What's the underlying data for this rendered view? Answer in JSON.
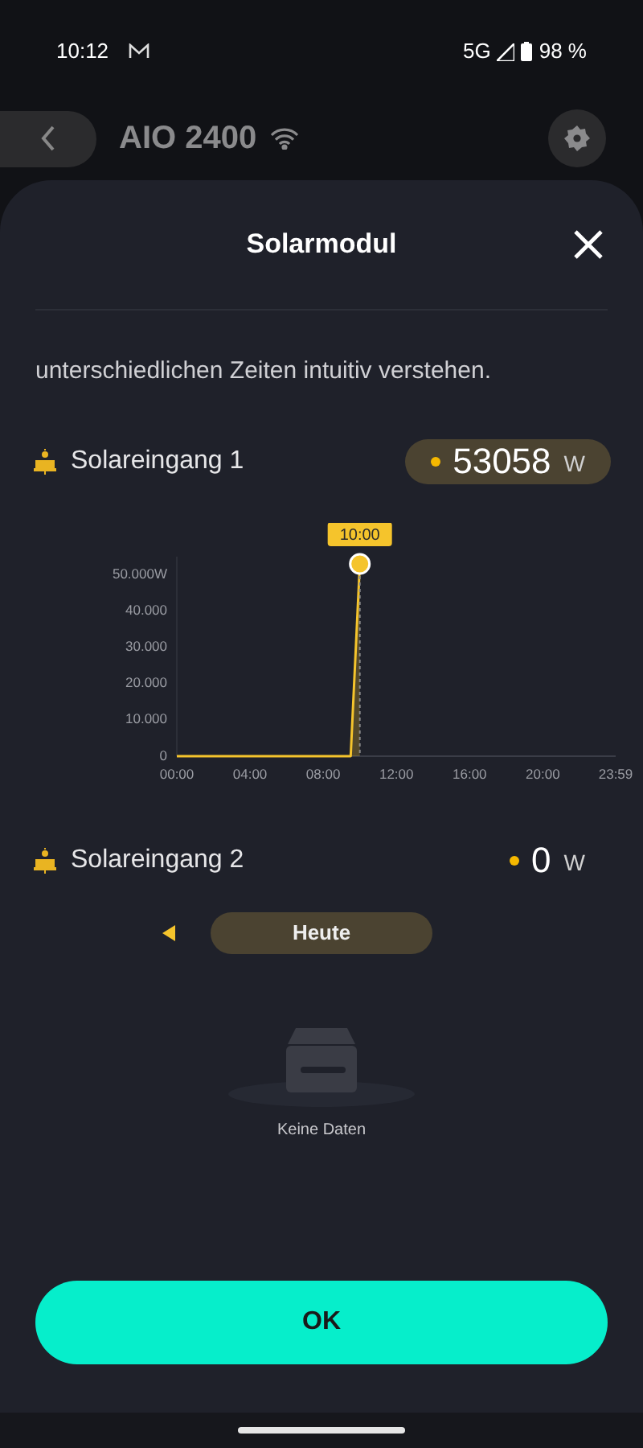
{
  "status_bar": {
    "time": "10:12",
    "network": "5G",
    "battery": "98 %"
  },
  "header": {
    "title": "AIO 2400"
  },
  "sheet": {
    "title": "Solarmodul",
    "intro": "unterschiedlichen Zeiten intuitiv verstehen.",
    "inputs": [
      {
        "label": "Solareingang 1",
        "value": "53058",
        "unit": "W",
        "highlighted": true,
        "chart_data": {
          "type": "line",
          "x": [
            0,
            9.5,
            10
          ],
          "values": [
            0,
            0,
            53000
          ],
          "xlim": [
            0,
            23.98
          ],
          "xticks": [
            {
              "value": 0,
              "label": "00:00"
            },
            {
              "value": 4,
              "label": "04:00"
            },
            {
              "value": 8,
              "label": "08:00"
            },
            {
              "value": 12,
              "label": "12:00"
            },
            {
              "value": 16,
              "label": "16:00"
            },
            {
              "value": 20,
              "label": "20:00"
            },
            {
              "value": 23.98,
              "label": "23:59"
            }
          ],
          "yticks": [
            {
              "value": 0,
              "label": "0"
            },
            {
              "value": 10000,
              "label": "10.000"
            },
            {
              "value": 20000,
              "label": "20.000"
            },
            {
              "value": 30000,
              "label": "30.000"
            },
            {
              "value": 40000,
              "label": "40.000"
            },
            {
              "value": 50000,
              "label": "50.000W"
            }
          ],
          "ylim": [
            0,
            55000
          ],
          "ref_lines": [
            {
              "axis": "x",
              "value": 10
            }
          ],
          "annotations": [
            {
              "x": 10,
              "y": 53000,
              "text": "10:00"
            }
          ]
        }
      },
      {
        "label": "Solareingang 2",
        "value": "0",
        "unit": "W",
        "highlighted": false
      }
    ],
    "date_button": "Heute",
    "empty_text": "Keine Daten",
    "ok_button": "OK"
  }
}
